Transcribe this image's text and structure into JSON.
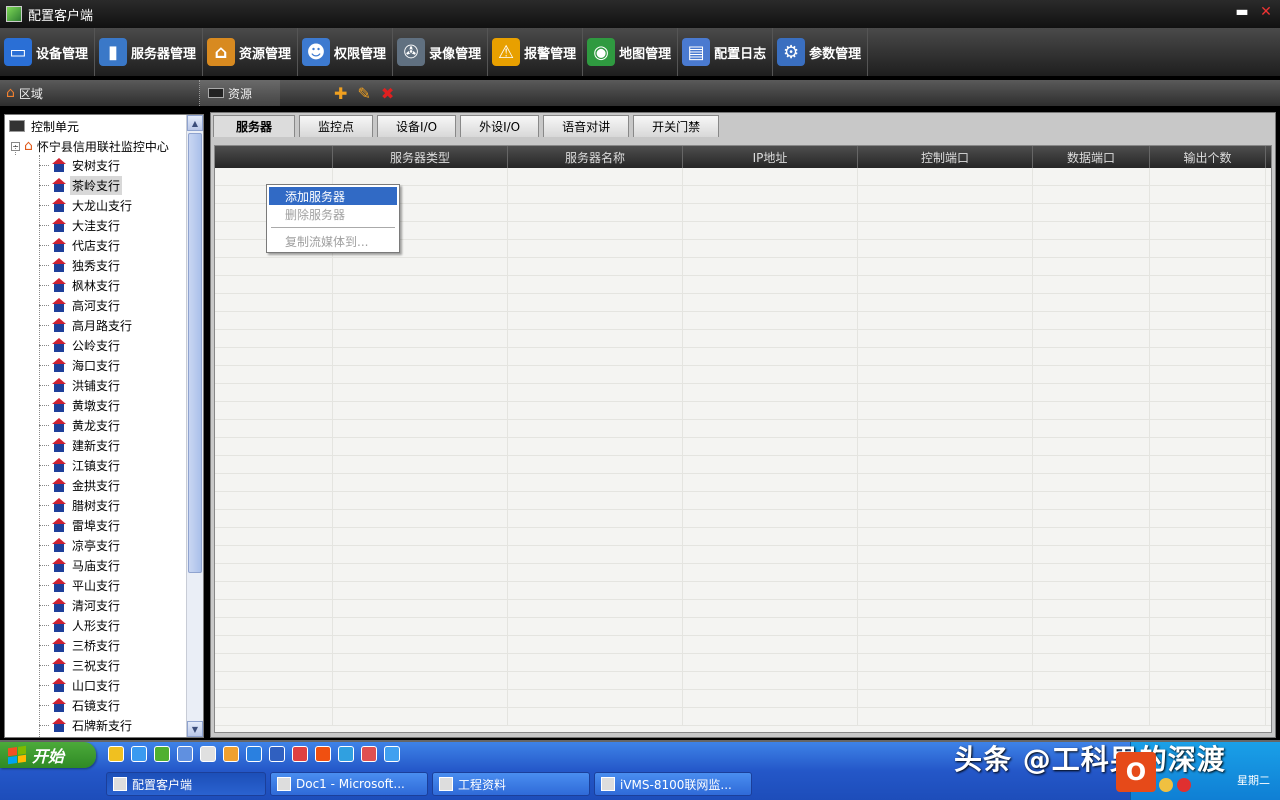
{
  "window": {
    "title": "配置客户端",
    "minimize": "▬",
    "close": "✕"
  },
  "toolbar": [
    {
      "label": "设备管理",
      "icon": "device-icon",
      "color": "#2a6fd6",
      "glyph": "▭"
    },
    {
      "label": "服务器管理",
      "icon": "server-icon",
      "color": "#3a78c8",
      "glyph": "▮"
    },
    {
      "label": "资源管理",
      "icon": "resource-icon",
      "color": "#d88a20",
      "glyph": "⌂"
    },
    {
      "label": "权限管理",
      "icon": "permission-icon",
      "color": "#3d7ad0",
      "glyph": "☻"
    },
    {
      "label": "录像管理",
      "icon": "recording-icon",
      "color": "#607080",
      "glyph": "✇"
    },
    {
      "label": "报警管理",
      "icon": "alarm-icon",
      "color": "#e8a000",
      "glyph": "⚠"
    },
    {
      "label": "地图管理",
      "icon": "map-icon",
      "color": "#2f9a40",
      "glyph": "◉"
    },
    {
      "label": "配置日志",
      "icon": "log-icon",
      "color": "#4a7ad0",
      "glyph": "▤"
    },
    {
      "label": "参数管理",
      "icon": "parameter-icon",
      "color": "#3a6fc0",
      "glyph": "⚙"
    }
  ],
  "subbar": {
    "area_label": "区域",
    "resource_label": "资源",
    "add": "✚",
    "edit": "✎",
    "delete": "✖"
  },
  "tree": {
    "root": "控制单元",
    "center": "怀宁县信用联社监控中心",
    "branches": [
      "安树支行",
      "茶岭支行",
      "大龙山支行",
      "大洼支行",
      "代店支行",
      "独秀支行",
      "枫林支行",
      "高河支行",
      "高月路支行",
      "公岭支行",
      "海口支行",
      "洪铺支行",
      "黄墩支行",
      "黄龙支行",
      "建新支行",
      "江镇支行",
      "金拱支行",
      "腊树支行",
      "雷埠支行",
      "凉亭支行",
      "马庙支行",
      "平山支行",
      "清河支行",
      "人形支行",
      "三桥支行",
      "三祝支行",
      "山口支行",
      "石镜支行",
      "石牌新支行"
    ],
    "selected": 1
  },
  "tabs": [
    "服务器",
    "监控点",
    "设备I/O",
    "外设I/O",
    "语音对讲",
    "开关门禁"
  ],
  "active_tab": 0,
  "grid": {
    "columns": [
      "",
      "服务器类型",
      "服务器名称",
      "IP地址",
      "控制端口",
      "数据端口",
      "输出个数"
    ]
  },
  "context_menu": {
    "items": [
      {
        "label": "添加服务器",
        "state": "highlighted"
      },
      {
        "label": "删除服务器",
        "state": "disabled"
      },
      {
        "label": "复制流媒体到...",
        "state": "disabled"
      }
    ]
  },
  "taskbar": {
    "start_label": "开始",
    "tasks": [
      "配置客户端",
      "Doc1 - Microsoft...",
      "工程资料",
      "iVMS-8100联网监..."
    ],
    "active_task": 0,
    "clock": "星期二"
  },
  "watermark": "头条 @工科男的深渡",
  "office_logo": "O"
}
